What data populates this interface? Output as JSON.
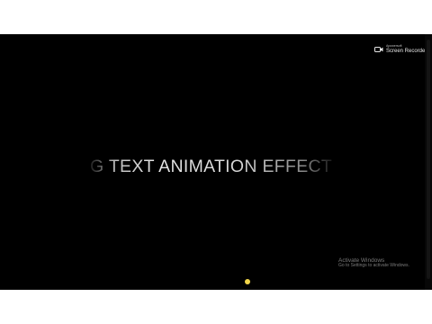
{
  "recorder": {
    "line1": "Apowersoft",
    "line2": "Screen Recorder",
    "icon": "video-camera-icon"
  },
  "headline": "G TEXT ANIMATION EFFECT",
  "watermark": {
    "title": "Activate Windows",
    "subtitle": "Go to Settings to activate Windows."
  },
  "colors": {
    "background": "#000000",
    "letterbox": "#ffffff",
    "text": "#d9d9d9",
    "cursor": "#f2d64a"
  }
}
